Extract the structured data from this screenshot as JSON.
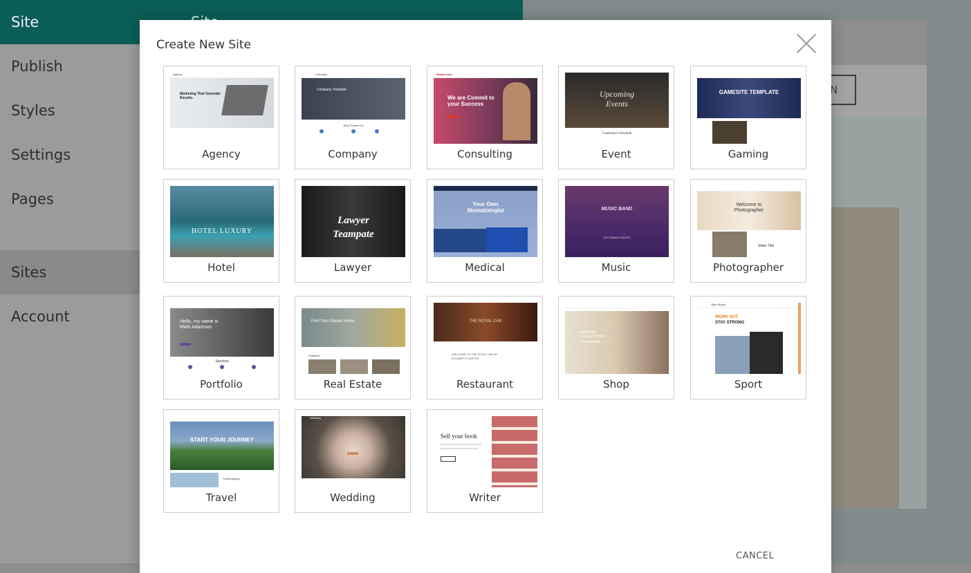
{
  "background": {
    "sidebar": {
      "title": "Site",
      "items": [
        "Publish",
        "Styles",
        "Settings",
        "Pages"
      ],
      "items2": [
        "Sites",
        "Account"
      ]
    },
    "panel": {
      "title": "Site"
    },
    "canvas": {
      "button_text": "N"
    }
  },
  "modal": {
    "title": "Create New Site",
    "cancel_label": "CANCEL"
  },
  "templates": [
    {
      "label": "Agency",
      "thumb_text": [
        "Agency",
        "Marketing That Generate Results."
      ]
    },
    {
      "label": "Company",
      "thumb_text": [
        "Company",
        "Company Template",
        "Why Choose Us"
      ]
    },
    {
      "label": "Consulting",
      "thumb_text": [
        "Megascopic",
        "We are Commit to your Success"
      ]
    },
    {
      "label": "Event",
      "thumb_text": [
        "Upcoming",
        "Events",
        "Conference Schedule"
      ]
    },
    {
      "label": "Gaming",
      "thumb_text": [
        "GAMESITE TEMPLATE"
      ]
    },
    {
      "label": "Hotel",
      "thumb_text": [
        "HOTEL LUXURY"
      ]
    },
    {
      "label": "Lawyer",
      "thumb_text": [
        "Lawyer",
        "Teampate"
      ]
    },
    {
      "label": "Medical",
      "thumb_text": [
        "Your Own",
        "Stomatologist"
      ]
    },
    {
      "label": "Music",
      "thumb_text": [
        "MUSIC BAND",
        "UPCOMING EVENTS"
      ]
    },
    {
      "label": "Photographer",
      "thumb_text": [
        "Welcome to",
        "Photographer",
        "Slider Title"
      ]
    },
    {
      "label": "Portfolio",
      "thumb_text": [
        "Hello, my name is Mark Adamson",
        "Services"
      ]
    },
    {
      "label": "Real Estate",
      "thumb_text": [
        "Find Your Dream Home",
        "Featured"
      ]
    },
    {
      "label": "Restaurant",
      "thumb_text": [
        "THE ROYAL OAK",
        "WELCOME TO THE ROYAL OAK BY ELIZABETH CARTER"
      ]
    },
    {
      "label": "Shop",
      "thumb_text": [
        "AMAZING COLLECTIONS",
        "New Arrivals"
      ]
    },
    {
      "label": "Sport",
      "thumb_text": [
        "Gym Studio",
        "WORK OUT",
        "STAY STRONG"
      ]
    },
    {
      "label": "Travel",
      "thumb_text": [
        "START YOUR JOURNEY",
        "Travel Agency"
      ]
    },
    {
      "label": "Wedding",
      "thumb_text": [
        "Wedding"
      ]
    },
    {
      "label": "Writer",
      "thumb_text": [
        "Sell your book"
      ]
    }
  ],
  "colors": {
    "sidebar_header": "#0b5e57",
    "consulting": "#c84a6a",
    "music": "#4a2a6a",
    "gaming": "#1e2a55"
  }
}
